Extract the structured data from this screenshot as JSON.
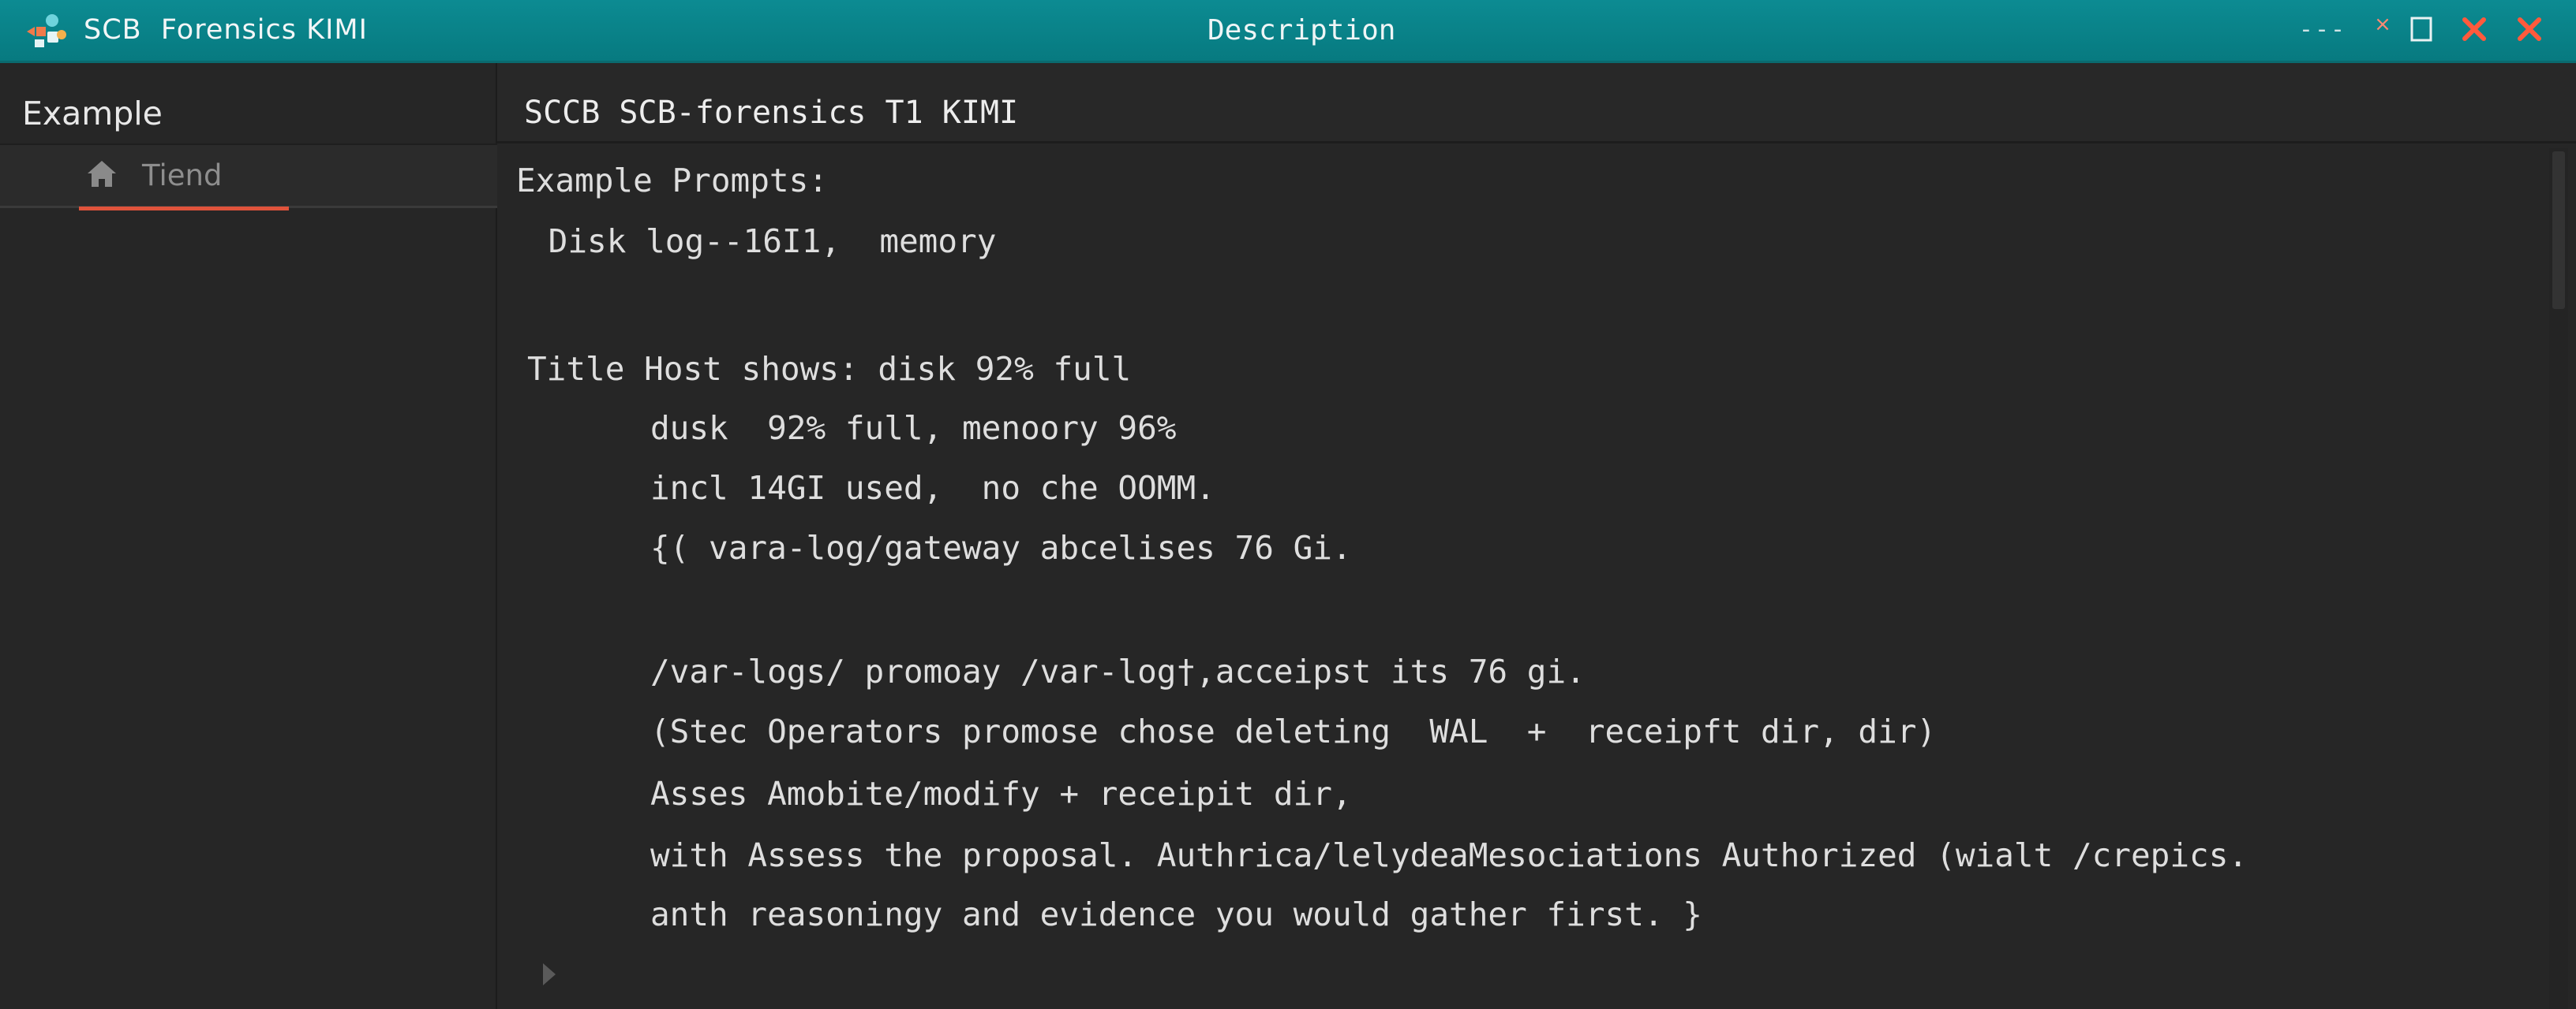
{
  "titlebar": {
    "app_title": "SCB  Forensics KIMI",
    "window_title": "Description",
    "minimize_glyph": "---",
    "small_close_glyph": "×",
    "icons": [
      "app-logo-icon",
      "minimize-icon",
      "small-close-icon",
      "maximize-icon",
      "close-icon",
      "close-icon"
    ]
  },
  "sidebar": {
    "heading": "Example",
    "items": [
      {
        "label": "Tiend",
        "icon": "home-icon",
        "active": true
      }
    ]
  },
  "main": {
    "title": "SCCB SCB-forensics T1 KIMI",
    "lines": [
      "Example Prompts:",
      " Disk log--16I1,  memory",
      "Title Host shows: disk 92% full",
      "dusk  92% full, menoory 96%",
      "incl 14GI used,  no che OOMM.",
      "{( vara-log/gateway abcelises 76 Gi.",
      "/var-logs/ promoay /var-log†,acceipst its 76 gi.",
      "(Stec Operators promose chose deleting  WAL  +  receipft dir, dir)",
      "Asses Amobite/modify + receipit dir,",
      "with Assess the proposal. Authrica/lelydeaMesociations Authorized (wialt /crepics.",
      "anth reasoningy and evidence you would gather first. }"
    ]
  },
  "colors": {
    "titlebar": "#0a848a",
    "background": "#262626",
    "accent_underline": "#e0533b",
    "close_icon": "#ff5a3c",
    "text": "#dedede"
  }
}
